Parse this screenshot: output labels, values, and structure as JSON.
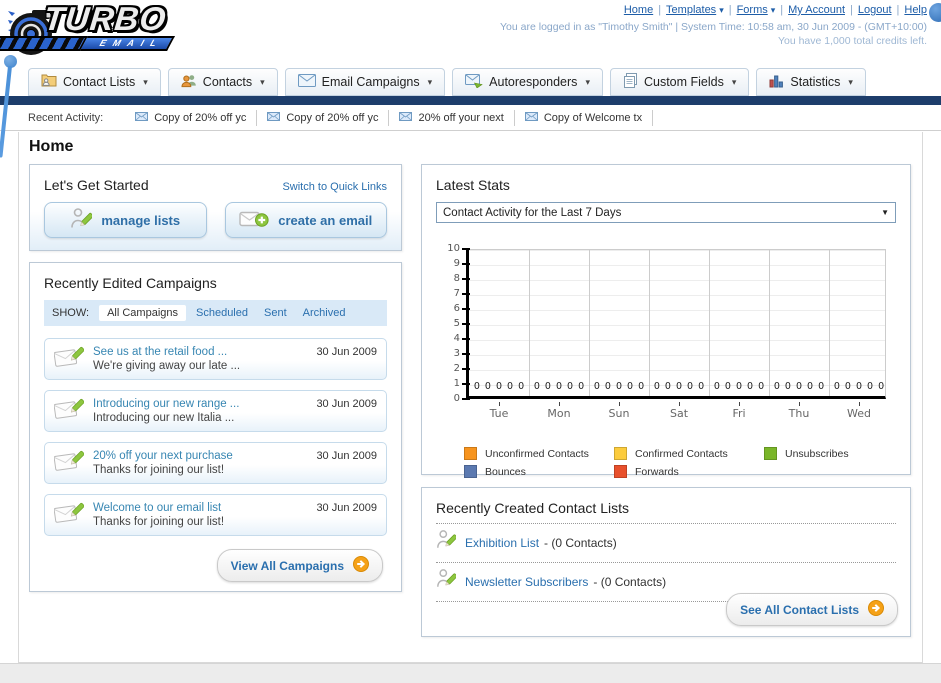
{
  "brand": {
    "name_top": "TURBO",
    "name_bottom": "EMAIL"
  },
  "icons": {
    "chevron_down": "▾",
    "select_caret": "▼"
  },
  "header": {
    "links": [
      {
        "label": "Home"
      },
      {
        "label": "Templates",
        "dropdown": true
      },
      {
        "label": "Forms",
        "dropdown": true
      },
      {
        "label": "My Account"
      },
      {
        "label": "Logout"
      },
      {
        "label": "Help"
      }
    ],
    "login_info": "You are logged in as \"Timothy Smith\" | System Time: 10:58 am, 30 Jun 2009 - (GMT+10:00)",
    "credits_info": "You have 1,000 total credits left."
  },
  "nav_tabs": [
    {
      "label": "Contact Lists"
    },
    {
      "label": "Contacts"
    },
    {
      "label": "Email Campaigns"
    },
    {
      "label": "Autoresponders"
    },
    {
      "label": "Custom Fields"
    },
    {
      "label": "Statistics"
    }
  ],
  "recent_activity": {
    "label": "Recent Activity:",
    "items": [
      "Copy of 20% off yc",
      "Copy of 20% off yc",
      "20% off your next",
      "Copy of Welcome tx"
    ]
  },
  "page_title": "Home",
  "get_started": {
    "title": "Let's Get Started",
    "switch_link": "Switch to Quick Links",
    "buttons": [
      {
        "label": "manage lists"
      },
      {
        "label": "create an email"
      }
    ]
  },
  "campaigns": {
    "title": "Recently Edited Campaigns",
    "show_label": "SHOW:",
    "filters": [
      {
        "label": "All Campaigns",
        "active": true
      },
      {
        "label": "Scheduled"
      },
      {
        "label": "Sent"
      },
      {
        "label": "Archived"
      }
    ],
    "items": [
      {
        "title": "See us at the retail food ...",
        "subtitle": "We're giving away our late ...",
        "date": "30 Jun 2009"
      },
      {
        "title": "Introducing our new range ...",
        "subtitle": "Introducing our new Italia ...",
        "date": "30 Jun 2009"
      },
      {
        "title": "20% off your next purchase",
        "subtitle": "Thanks for joining our list!",
        "date": "30 Jun 2009"
      },
      {
        "title": "Welcome to our email list",
        "subtitle": "Thanks for joining our list!",
        "date": "30 Jun 2009"
      }
    ],
    "view_all_label": "View All Campaigns"
  },
  "stats": {
    "title": "Latest Stats",
    "dropdown_value": "Contact Activity for the Last 7 Days"
  },
  "chart_data": {
    "type": "bar",
    "title": "Contact Activity for the Last 7 Days",
    "categories": [
      "Tue",
      "Mon",
      "Sun",
      "Sat",
      "Fri",
      "Thu",
      "Wed"
    ],
    "series": [
      {
        "name": "Unconfirmed Contacts",
        "color": "#f7941e",
        "values": [
          0,
          0,
          0,
          0,
          0,
          0,
          0
        ]
      },
      {
        "name": "Confirmed Contacts",
        "color": "#fccc3d",
        "values": [
          0,
          0,
          0,
          0,
          0,
          0,
          0
        ]
      },
      {
        "name": "Unsubscribes",
        "color": "#7ab629",
        "values": [
          0,
          0,
          0,
          0,
          0,
          0,
          0
        ]
      },
      {
        "name": "Bounces",
        "color": "#5b79b0",
        "values": [
          0,
          0,
          0,
          0,
          0,
          0,
          0
        ]
      },
      {
        "name": "Forwards",
        "color": "#e8502c",
        "values": [
          0,
          0,
          0,
          0,
          0,
          0,
          0
        ]
      }
    ],
    "ylim": [
      0,
      10
    ],
    "yticks": [
      0,
      1,
      2,
      3,
      4,
      5,
      6,
      7,
      8,
      9,
      10
    ],
    "grid": true,
    "legend_position": "bottom",
    "value_labels_shown": true
  },
  "contact_lists": {
    "title": "Recently Created Contact Lists",
    "items": [
      {
        "name": "Exhibition List",
        "detail": "- (0 Contacts)"
      },
      {
        "name": "Newsletter Subscribers",
        "detail": "- (0 Contacts)"
      }
    ],
    "see_all_label": "See All Contact Lists"
  }
}
